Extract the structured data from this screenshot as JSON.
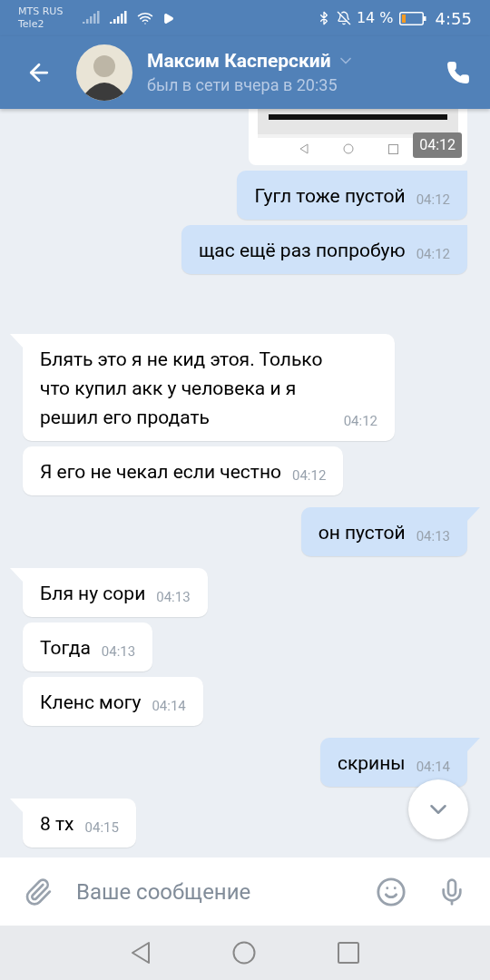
{
  "status_bar": {
    "carriers": [
      "MTS RUS",
      "Tele2"
    ],
    "battery_text": "14 %",
    "time": "4:55"
  },
  "header": {
    "name": "Максим Касперский",
    "status": "был в сети вчера в 20:35"
  },
  "attachment": {
    "outgoing": true,
    "time": "04:12"
  },
  "messages": [
    {
      "outgoing": true,
      "tail": false,
      "text": "Гугл тоже пустой",
      "time": "04:12"
    },
    {
      "outgoing": true,
      "tail": false,
      "text": "щас ещё раз попробую",
      "time": "04:12"
    },
    {
      "outgoing": false,
      "tail": true,
      "text": "Блять это я не кид этоя. Только что купил акк у человека и я решил его продать",
      "time": "04:12"
    },
    {
      "outgoing": false,
      "tail": false,
      "text": "Я его не чекал если честно",
      "time": "04:12"
    },
    {
      "outgoing": true,
      "tail": true,
      "text": "он пустой",
      "time": "04:13"
    },
    {
      "outgoing": false,
      "tail": true,
      "text": "Бля ну сори",
      "time": "04:13"
    },
    {
      "outgoing": false,
      "tail": false,
      "text": "Тогда",
      "time": "04:13"
    },
    {
      "outgoing": false,
      "tail": false,
      "text": "Кленс могу",
      "time": "04:14"
    },
    {
      "outgoing": true,
      "tail": true,
      "text": "скрины",
      "time": "04:14"
    },
    {
      "outgoing": false,
      "tail": true,
      "text": "8 тх",
      "time": "04:15"
    }
  ],
  "composer": {
    "placeholder": "Ваше сообщение"
  }
}
